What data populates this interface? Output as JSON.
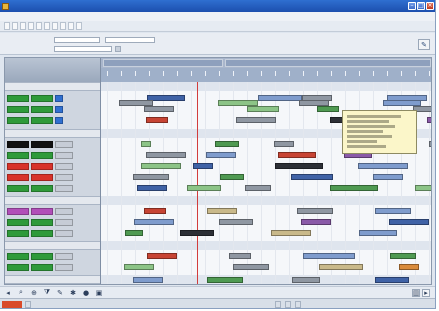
{
  "window": {
    "title": ""
  },
  "menu": [
    "",
    "",
    "",
    "",
    "",
    "",
    "",
    "",
    ""
  ],
  "toolbar": [
    "",
    "",
    "",
    "",
    "",
    "",
    "",
    "",
    "",
    ""
  ],
  "filter": {
    "label1": "",
    "from": "",
    "to_label": "",
    "to": "",
    "label2": "",
    "selection": ""
  },
  "gantt": {
    "corner_title": "",
    "days": [
      "",
      ""
    ],
    "groups": [
      "",
      "",
      "",
      "",
      ""
    ]
  },
  "colors": {
    "green": "#2f9a3a",
    "red": "#d8322a",
    "black": "#111111",
    "purple": "#b14fb8",
    "accent": "#2f6fd0"
  },
  "status": {
    "left": "",
    "s1": "",
    "s2": "",
    "s3": ""
  }
}
